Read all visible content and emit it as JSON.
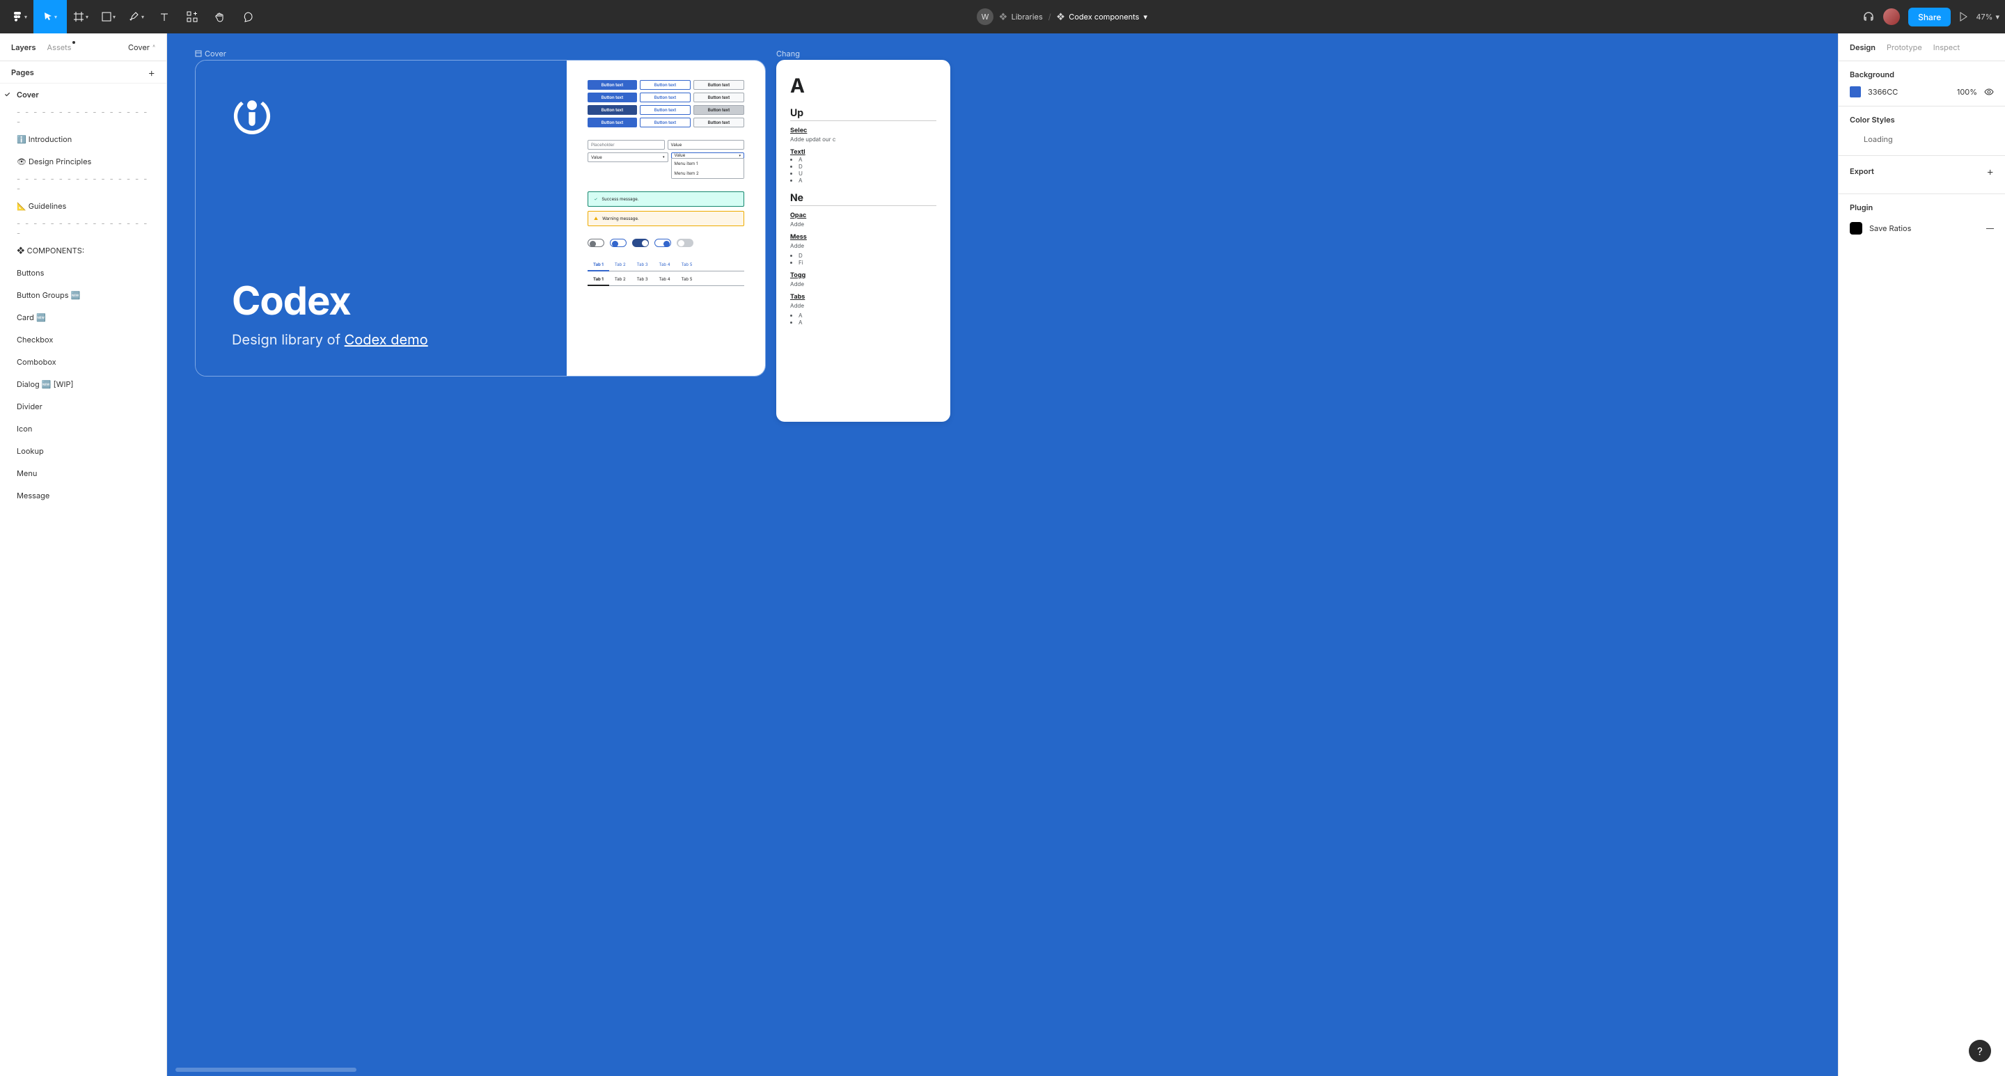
{
  "toolbar": {
    "avatar_letter": "W",
    "breadcrumb_1": "Libraries",
    "breadcrumb_2": "Codex components",
    "share_label": "Share",
    "zoom": "47%"
  },
  "left": {
    "tab_layers": "Layers",
    "tab_assets": "Assets",
    "page_selector": "Cover",
    "pages_header": "Pages",
    "pages": [
      {
        "label": "Cover",
        "current": true
      },
      {
        "label": "- - - - - - - - - - - - - - - - - ",
        "sep": true
      },
      {
        "label": "ℹ️ Introduction"
      },
      {
        "label": "👁 Design Principles"
      },
      {
        "label": "- - - - - - - - - - - - - - - - - ",
        "sep": true
      },
      {
        "label": "📐 Guidelines"
      },
      {
        "label": "- - - - - - - - - - - - - - - - - ",
        "sep": true
      },
      {
        "label": "❖ COMPONENTS:"
      },
      {
        "label": "Buttons"
      },
      {
        "label": "Button Groups 🆕"
      },
      {
        "label": "Card 🆕"
      },
      {
        "label": "Checkbox"
      },
      {
        "label": "Combobox"
      },
      {
        "label": "Dialog 🆕 [WIP]"
      },
      {
        "label": "Divider"
      },
      {
        "label": "Icon"
      },
      {
        "label": "Lookup"
      },
      {
        "label": "Menu"
      },
      {
        "label": "Message"
      }
    ]
  },
  "canvas": {
    "frame_label": "Cover",
    "title": "Codex",
    "subtitle_prefix": "Design library of ",
    "subtitle_link": "Codex demo",
    "change_label": "Chang",
    "mini": {
      "button_text": "Button text",
      "placeholder": "Placeholder",
      "value": "Value",
      "menu_item_1": "Menu item 1",
      "menu_item_2": "Menu item 2",
      "success": "Success message.",
      "warning": "Warning message.",
      "tabs": [
        "Tab 1",
        "Tab 2",
        "Tab 3",
        "Tab 4",
        "Tab 5"
      ]
    },
    "changelog": {
      "big_a": "A",
      "up_heading": "Up",
      "select_title": "Selec",
      "select_desc": "Adde\nupdat\nour c",
      "texti_title": "TextI",
      "texti_items": [
        "A",
        "D",
        "U",
        "A"
      ],
      "new_heading": "Ne",
      "opac_title": "Opac",
      "opac_desc": "Adde",
      "mess_title": "Mess",
      "mess_desc": "Adde",
      "mess_items": [
        "D",
        "Fi"
      ],
      "toggle_title": "Togg",
      "toggle_desc": "Adde",
      "tabs_title": "Tabs",
      "tabs_desc": "Adde",
      "tabs_items": [
        "A",
        "A"
      ]
    }
  },
  "right": {
    "tab_design": "Design",
    "tab_prototype": "Prototype",
    "tab_inspect": "Inspect",
    "background_label": "Background",
    "bg_hex": "3366CC",
    "bg_opacity": "100%",
    "color_styles_label": "Color Styles",
    "loading": "Loading",
    "export_label": "Export",
    "plugin_label": "Plugin",
    "plugin_name": "Save Ratios"
  },
  "help": "?"
}
